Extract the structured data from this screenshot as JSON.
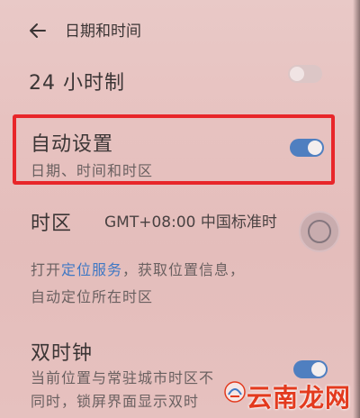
{
  "header": {
    "title": "日期和时间"
  },
  "rows": {
    "h24": {
      "title": "24 小时制",
      "enabled": false
    },
    "auto": {
      "title": "自动设置",
      "subtitle": "日期、时间和时区",
      "enabled": true
    },
    "timezone": {
      "title": "时区",
      "value": "GMT+08:00 中国标准时"
    },
    "tz_desc": {
      "line1_pre": "打开",
      "line1_link": "定位服务",
      "line1_post": "，获取位置信息，",
      "line2": "自动定位所在时区"
    },
    "dual": {
      "title": "双时钟",
      "line1": "当前位置与常驻城市时区不",
      "line2": "同时，锁屏界面显示双时",
      "enabled": true
    }
  },
  "watermark": {
    "text": "云南龙网"
  },
  "colors": {
    "accent": "#4f7fc0",
    "highlight": "#e8262a",
    "link": "#3f78c4"
  },
  "icons": {
    "back": "arrow-left-icon",
    "touch": "touch-indicator-icon"
  }
}
